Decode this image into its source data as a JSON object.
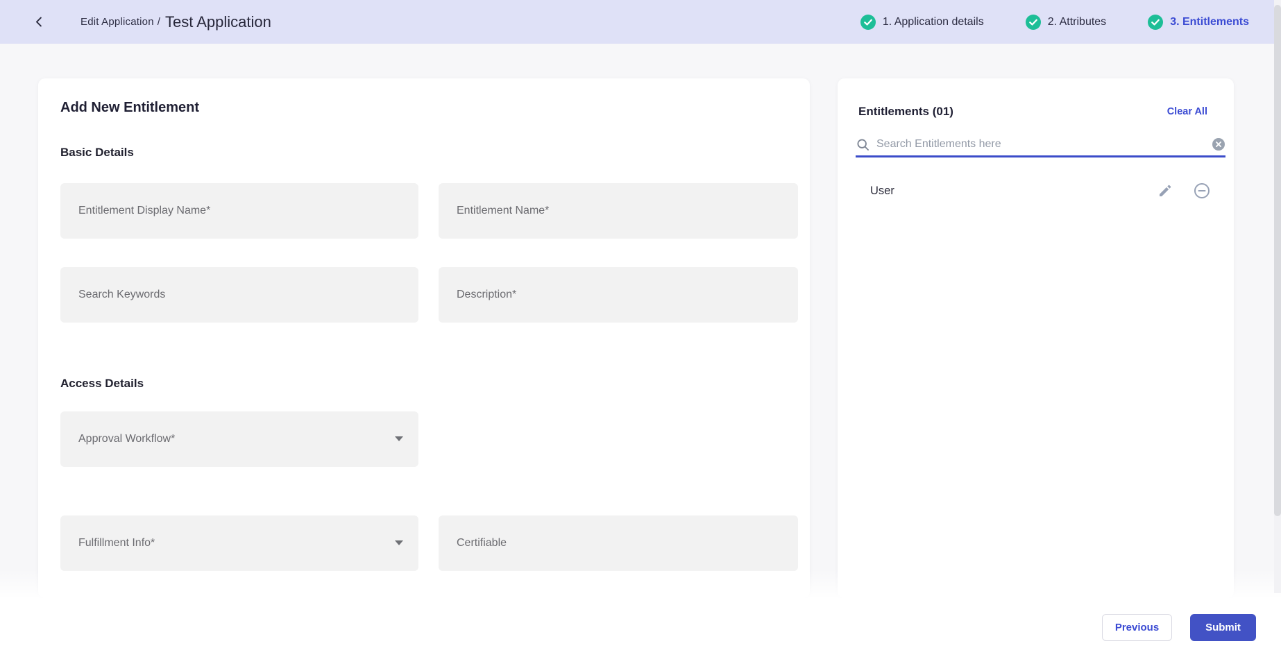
{
  "header": {
    "breadcrumb": {
      "section": "Edit Application",
      "separator": "/",
      "current": "Test Application"
    },
    "steps": [
      {
        "label": "1. Application details",
        "completed": true,
        "active": false
      },
      {
        "label": "2. Attributes",
        "completed": true,
        "active": false
      },
      {
        "label": "3. Entitlements",
        "completed": true,
        "active": true
      }
    ]
  },
  "form": {
    "title": "Add New Entitlement",
    "basic_section": {
      "title": "Basic Details",
      "fields": [
        {
          "placeholder": "Entitlement Display Name*",
          "value": ""
        },
        {
          "placeholder": "Entitlement Name*",
          "value": ""
        },
        {
          "placeholder": "Search Keywords",
          "value": ""
        },
        {
          "placeholder": "Description*",
          "value": ""
        }
      ]
    },
    "access_section": {
      "title": "Access Details",
      "fields": [
        {
          "placeholder": "Approval Workflow*",
          "dropdown": true,
          "value": ""
        },
        {
          "placeholder": "Fulfillment Info*",
          "dropdown": true,
          "value": ""
        },
        {
          "placeholder": "Certifiable",
          "dropdown": false,
          "value": ""
        }
      ]
    }
  },
  "entitlements_panel": {
    "title": "Entitlements (01)",
    "clear_all_label": "Clear All",
    "search": {
      "placeholder": "Search Entitlements here",
      "value": ""
    },
    "items": [
      {
        "name": "User"
      }
    ]
  },
  "footer": {
    "previous_label": "Previous",
    "submit_label": "Submit"
  },
  "icons": {
    "back": "chevron-left",
    "step_complete": "check-circle",
    "search": "magnifier",
    "clear_search": "x-circle",
    "edit": "pencil",
    "remove": "minus-circle",
    "dropdown": "caret-down"
  },
  "colors": {
    "header_bg": "#dfe1f7",
    "page_bg": "#f7f7f9",
    "accent_blue": "#3b4bd3",
    "submit_bg": "#4252c5",
    "success_green": "#1dbe97",
    "field_bg": "#f2f2f2",
    "icon_gray": "#97a1b5"
  }
}
